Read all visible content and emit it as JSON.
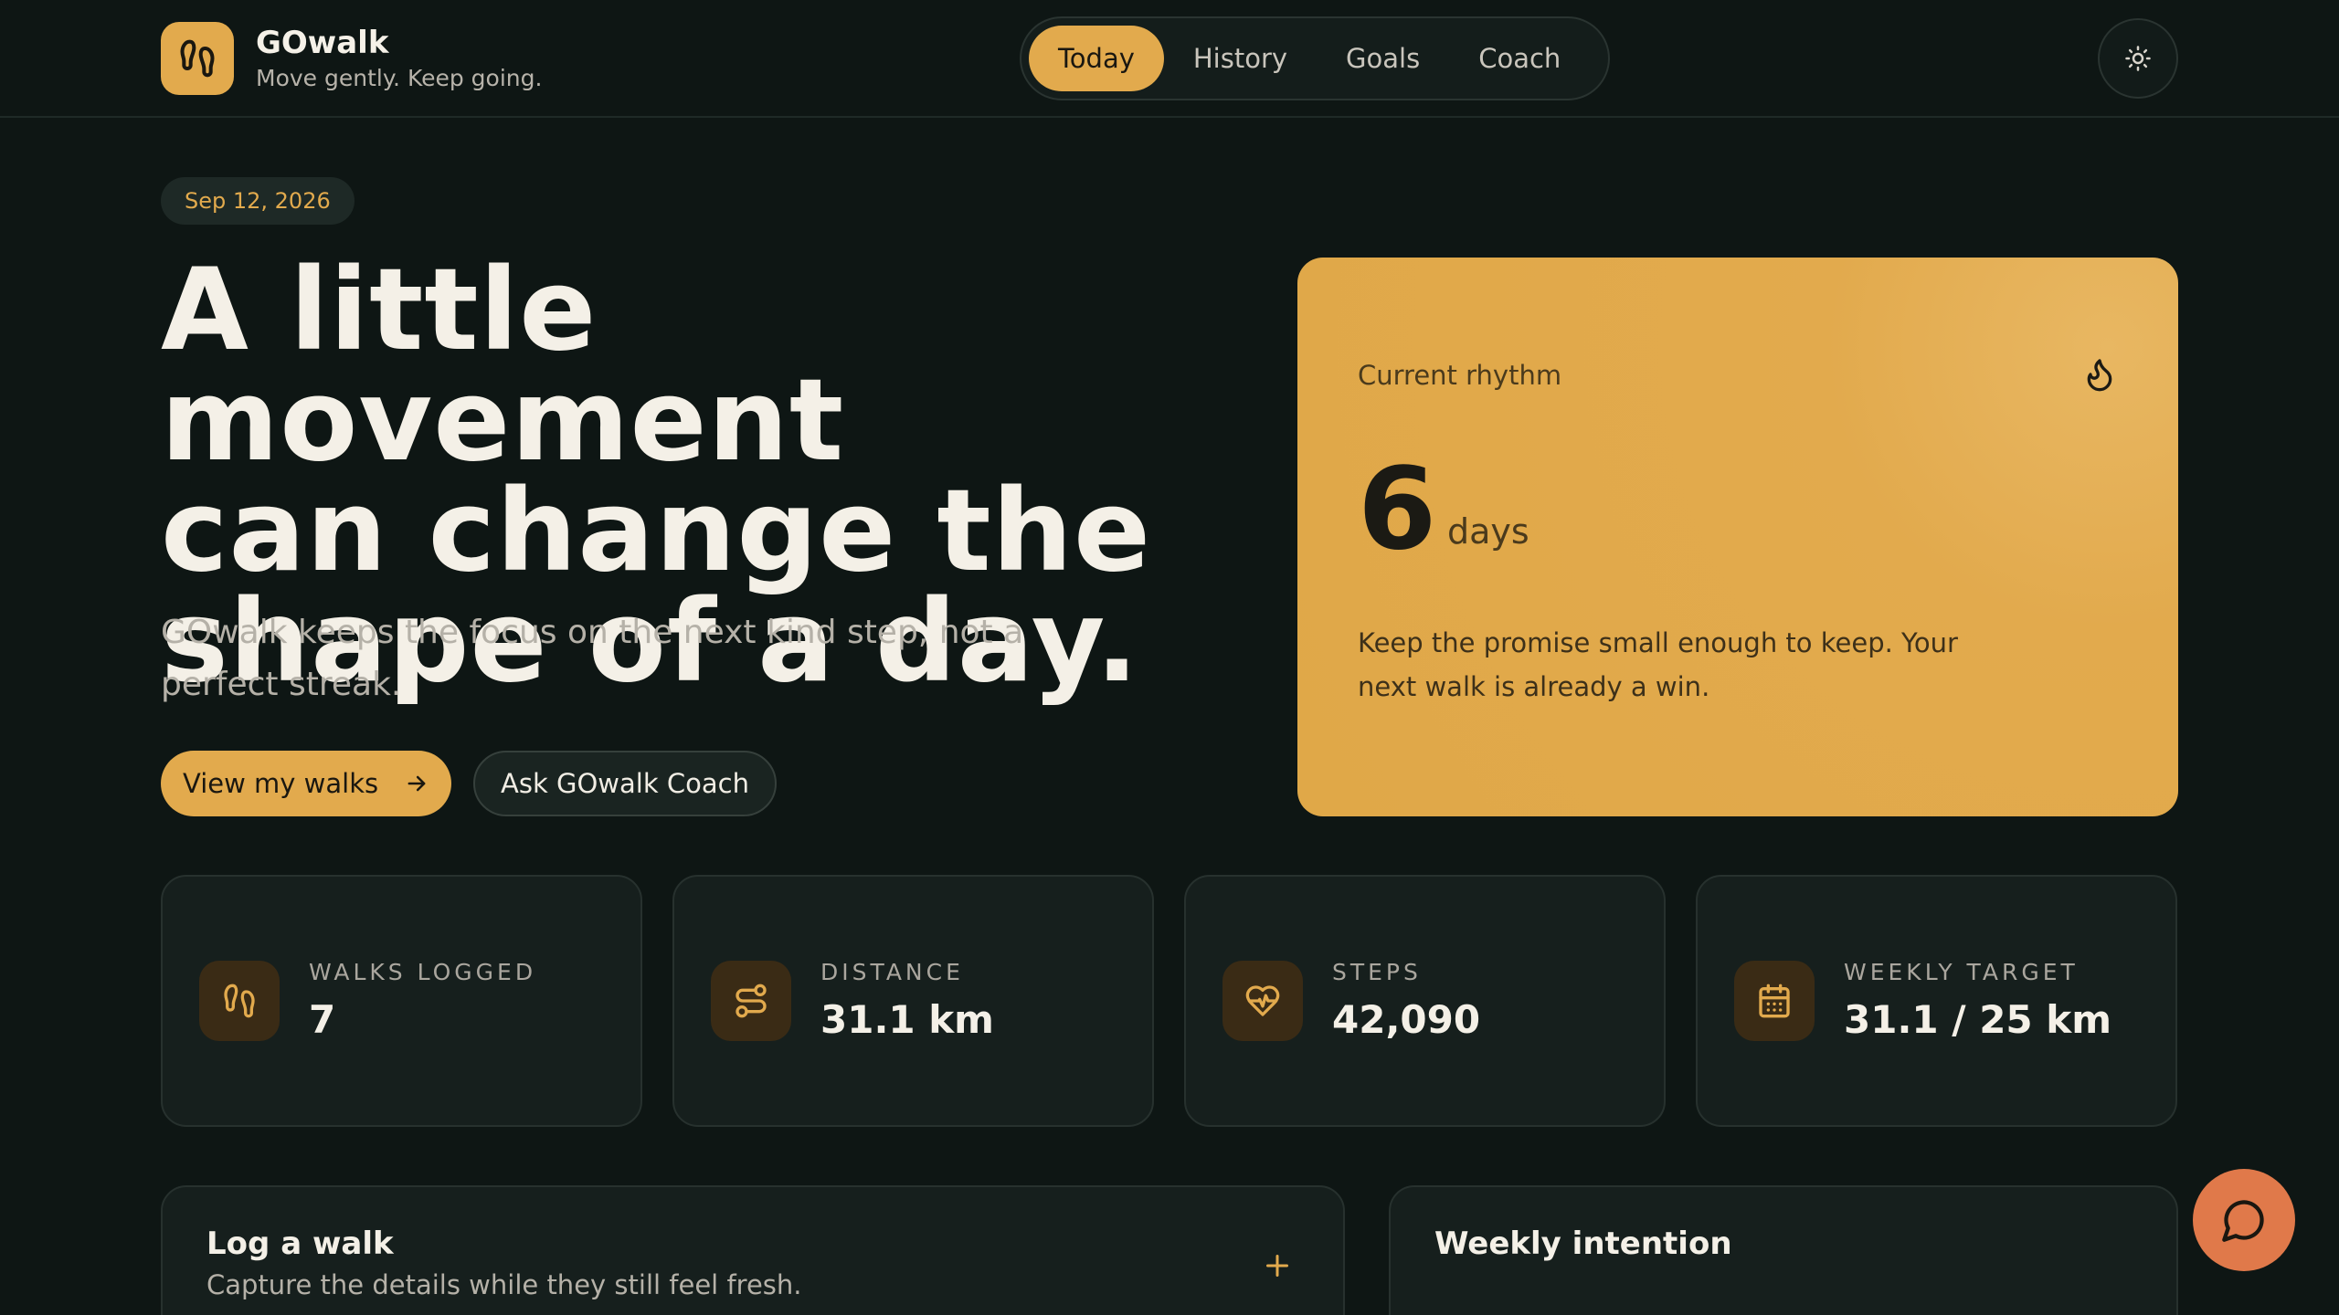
{
  "brand": {
    "name": "GOwalk",
    "tagline": "Move gently. Keep going."
  },
  "nav": {
    "tabs": [
      "Today",
      "History",
      "Goals",
      "Coach"
    ],
    "active": "Today"
  },
  "hero": {
    "date": "Sep 12, 2026",
    "title_lines": [
      "A little movement",
      "can change the",
      "shape of a day."
    ],
    "subtitle_lines": [
      "GOwalk keeps the focus on the next kind step, not a",
      "perfect streak."
    ],
    "primary_label": "View my walks",
    "secondary_label": "Ask GOwalk Coach"
  },
  "rhythm": {
    "label": "Current rhythm",
    "value": "6",
    "unit": "days",
    "note_lines": [
      "Keep the promise small enough to keep. Your",
      "next walk is already a win."
    ]
  },
  "stats": [
    {
      "label": "WALKS LOGGED",
      "value": "7",
      "icon": "footprints-icon"
    },
    {
      "label": "DISTANCE",
      "value": "31.1 km",
      "icon": "route-icon"
    },
    {
      "label": "STEPS",
      "value": "42,090",
      "icon": "heart-pulse-icon"
    },
    {
      "label": "WEEKLY TARGET",
      "value": "31.1 / 25 km",
      "icon": "calendar-icon"
    }
  ],
  "log_walk": {
    "title": "Log a walk",
    "subtitle": "Capture the details while they still feel fresh."
  },
  "intention": {
    "title": "Weekly intention"
  },
  "colors": {
    "accent": "#e2aa4d",
    "background": "#0e1614",
    "card": "#161f1d",
    "fab": "#e0794a"
  }
}
